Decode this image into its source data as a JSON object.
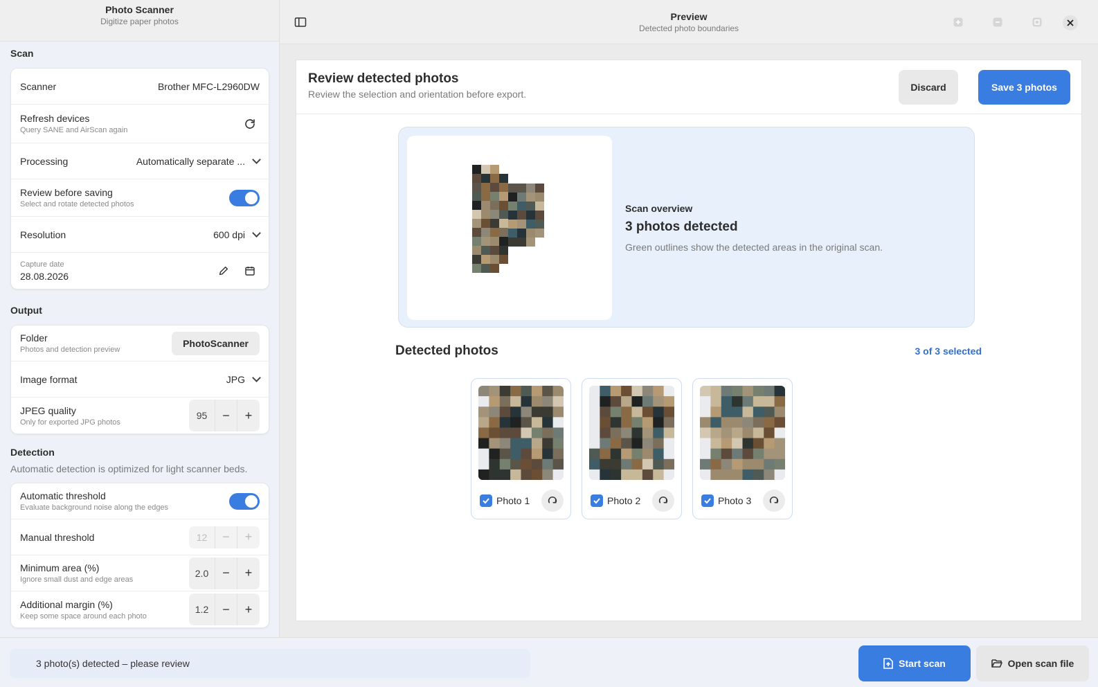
{
  "app": {
    "title": "Photo Scanner",
    "subtitle": "Digitize paper photos"
  },
  "scan": {
    "section_title": "Scan",
    "scanner_label": "Scanner",
    "scanner_value": "Brother MFC-L2960DW",
    "refresh_label": "Refresh devices",
    "refresh_sub": "Query SANE and AirScan again",
    "processing_label": "Processing",
    "processing_value": "Automatically separate ...",
    "review_label": "Review before saving",
    "review_sub": "Select and rotate detected photos",
    "review_on": true,
    "resolution_label": "Resolution",
    "resolution_value": "600 dpi",
    "date_label": "Capture date",
    "date_value": "28.08.2026"
  },
  "output": {
    "section_title": "Output",
    "folder_label": "Folder",
    "folder_sub": "Photos and detection preview",
    "folder_value": "PhotoScanner",
    "format_label": "Image format",
    "format_value": "JPG",
    "quality_label": "JPEG quality",
    "quality_sub": "Only for exported JPG photos",
    "quality_value": "95"
  },
  "detection": {
    "section_title": "Detection",
    "section_desc": "Automatic detection is optimized for light scanner beds.",
    "auto_label": "Automatic threshold",
    "auto_sub": "Evaluate background noise along the edges",
    "auto_on": true,
    "manual_label": "Manual threshold",
    "manual_value": "12",
    "min_area_label": "Minimum area (%)",
    "min_area_sub": "Ignore small dust and edge areas",
    "min_area_value": "2.0",
    "margin_label": "Additional margin (%)",
    "margin_sub": "Keep some space around each photo",
    "margin_value": "1.2"
  },
  "stepper": {
    "minus": "−",
    "plus": "+"
  },
  "preview": {
    "title": "Preview",
    "subtitle": "Detected photo boundaries"
  },
  "review": {
    "title": "Review detected photos",
    "subtitle": "Review the selection and orientation before export.",
    "discard_label": "Discard",
    "save_label": "Save 3 photos"
  },
  "overview": {
    "label": "Scan overview",
    "title": "3 photos detected",
    "desc": "Green outlines show the detected areas in the original scan."
  },
  "detected": {
    "title": "Detected photos",
    "count": "3 of 3 selected",
    "photos": [
      {
        "name": "Photo 1",
        "checked": true
      },
      {
        "name": "Photo 2",
        "checked": true
      },
      {
        "name": "Photo 3",
        "checked": true
      }
    ]
  },
  "footer": {
    "status": "3 photo(s) detected – please review",
    "start_label": "Start scan",
    "open_label": "Open scan file"
  },
  "colors": {
    "accent": "#3a7de0",
    "link": "#2f6fd3",
    "overview_bg": "#e8f0fb"
  }
}
